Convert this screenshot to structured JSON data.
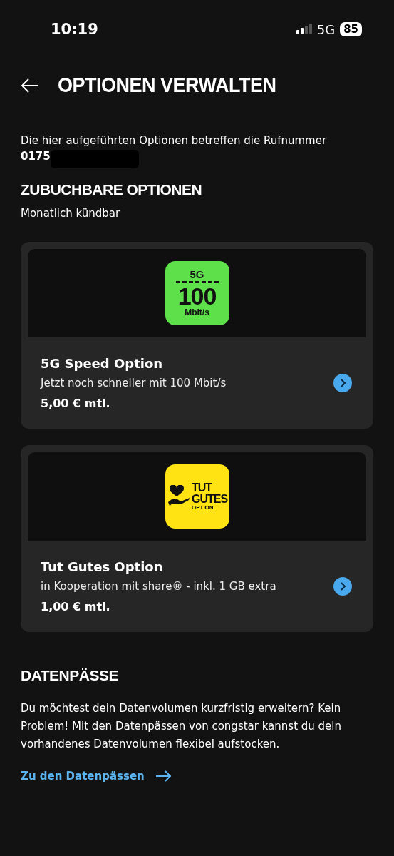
{
  "status_bar": {
    "time": "10:19",
    "network": "5G",
    "battery": "85"
  },
  "header": {
    "title": "OPTIONEN VERWALTEN"
  },
  "intro": {
    "text": "Die hier aufgeführten Optionen betreffen die Rufnummer",
    "number": "0175"
  },
  "section": {
    "title": "ZUBUCHBARE OPTIONEN",
    "subtitle": "Monatlich kündbar"
  },
  "options": [
    {
      "kind": "speed",
      "logo": [
        "5G",
        "100",
        "Mbit/s"
      ],
      "title": "5G Speed Option",
      "description": "Jetzt noch schneller mit 100 Mbit/s",
      "price": "5,00 € mtl."
    },
    {
      "kind": "charity",
      "logo": [
        "TUT",
        "GUTES",
        "OPTION"
      ],
      "title": "Tut Gutes Option",
      "description": "in Kooperation mit share® - inkl. 1 GB extra",
      "price": "1,00 € mtl."
    }
  ],
  "datapass": {
    "title": "DATENPÄSSE",
    "text": "Du möchtest dein Datenvolumen kurzfristig erweitern? Kein Problem! Mit den Datenpässen von congstar kannst du dein vorhandenes Datenvolumen flexibel aufstocken.",
    "link": "Zu den Datenpässen"
  }
}
